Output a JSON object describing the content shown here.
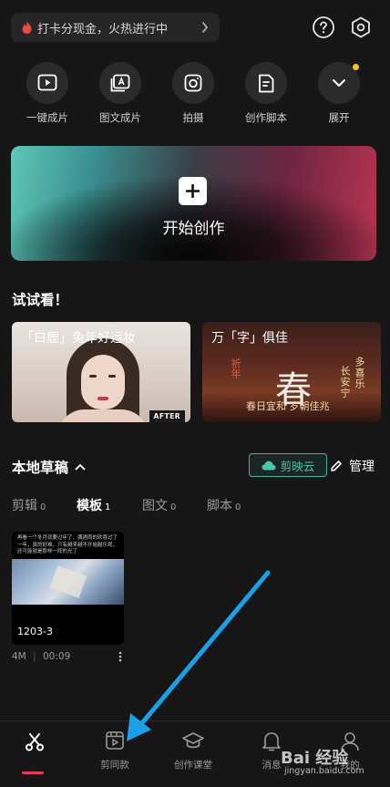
{
  "promo": {
    "text": "打卡分现金，火热进行中"
  },
  "quick_actions": [
    {
      "label": "一键成片",
      "icon": "play-icon"
    },
    {
      "label": "图文成片",
      "icon": "text-image-icon"
    },
    {
      "label": "拍摄",
      "icon": "camera-icon"
    },
    {
      "label": "创作脚本",
      "icon": "script-icon"
    },
    {
      "label": "展开",
      "icon": "chevron-down-icon"
    }
  ],
  "create": {
    "title": "开始创作"
  },
  "try": {
    "title": "试试看！",
    "cards": [
      {
        "title": "「白鹿」兔年好运妆",
        "badge": "AFTER"
      },
      {
        "title": "万「字」俱佳",
        "big_char": "春",
        "side_text": "祈年",
        "vertical_1": "多喜乐",
        "vertical_2": "长安宁",
        "bottom_text": "春日宜和 岁朝佳兆"
      }
    ]
  },
  "drafts": {
    "title": "本地草稿",
    "cloud_label": "剪映云",
    "manage_label": "管理",
    "tabs": [
      {
        "label": "剪辑",
        "count": "0"
      },
      {
        "label": "模板",
        "count": "1"
      },
      {
        "label": "图文",
        "count": "0"
      },
      {
        "label": "脚本",
        "count": "0"
      }
    ],
    "active_tab": "模板",
    "items": [
      {
        "caption": "再看一个冬月就要过年了，偶遇雨的欢喜过了一年，真的好难，只有越来越不开始越乐观，还可能就是那样一阵的光了",
        "name": "1203-3",
        "size": "4M",
        "duration": "00:09"
      }
    ]
  },
  "bottom_nav": [
    {
      "label": "",
      "icon": "scissors-icon",
      "active": true
    },
    {
      "label": "剪同款",
      "icon": "template-icon"
    },
    {
      "label": "创作课堂",
      "icon": "graduation-cap-icon"
    },
    {
      "label": "消息",
      "icon": "bell-icon"
    },
    {
      "label": "我的",
      "icon": "profile-icon"
    }
  ],
  "watermark": {
    "brand": "Bai 经验",
    "url": "jingyan.baidu.com"
  },
  "colors": {
    "accent": "#ea3a5a",
    "cloud": "#47c7ae",
    "arrow": "#1aa0e8"
  }
}
